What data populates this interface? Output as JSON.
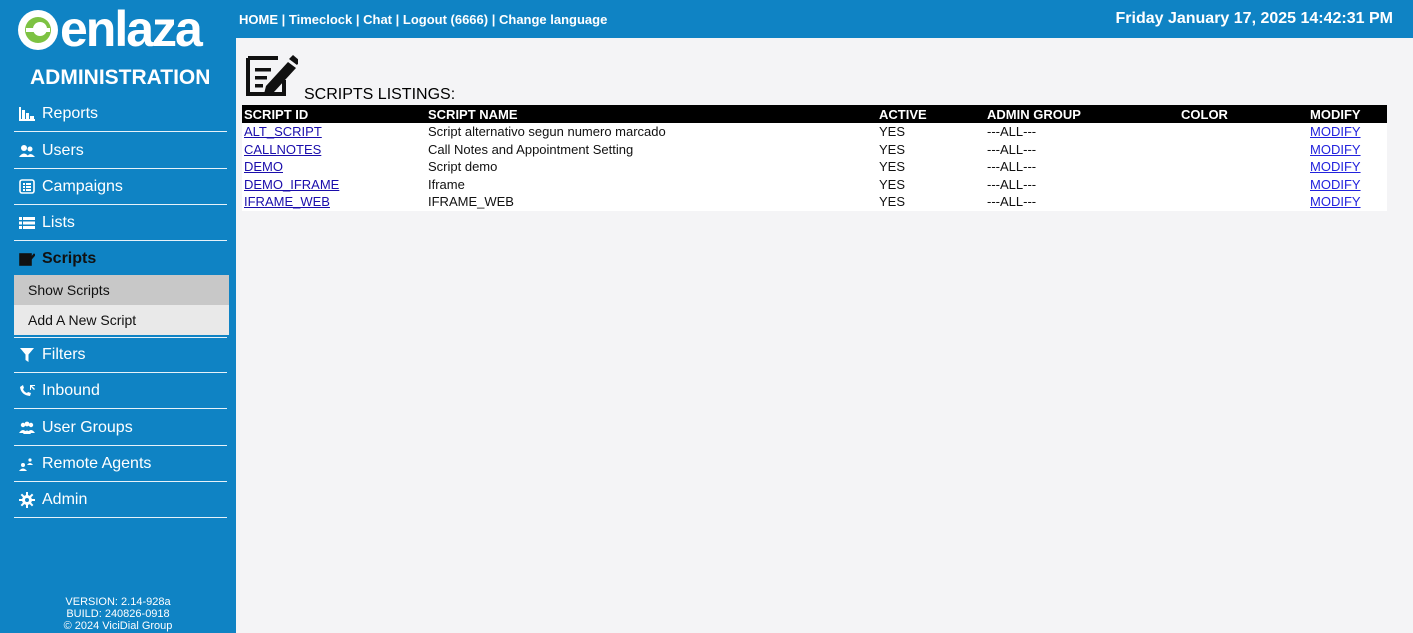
{
  "brand": {
    "logo_text": "enlaza",
    "section_title": "ADMINISTRATION"
  },
  "sidebar": {
    "items": [
      {
        "label": "Reports",
        "icon": "reports-icon"
      },
      {
        "label": "Users",
        "icon": "users-icon"
      },
      {
        "label": "Campaigns",
        "icon": "campaigns-icon"
      },
      {
        "label": "Lists",
        "icon": "lists-icon"
      },
      {
        "label": "Scripts",
        "icon": "scripts-icon",
        "active": true
      },
      {
        "label": "Filters",
        "icon": "filter-icon"
      },
      {
        "label": "Inbound",
        "icon": "inbound-icon"
      },
      {
        "label": "User Groups",
        "icon": "user-groups-icon"
      },
      {
        "label": "Remote Agents",
        "icon": "remote-agents-icon"
      },
      {
        "label": "Admin",
        "icon": "gear-icon"
      }
    ],
    "sub_items": [
      {
        "label": "Show Scripts",
        "selected": true
      },
      {
        "label": "Add A New Script",
        "selected": false
      }
    ],
    "footer": {
      "version": "VERSION: 2.14-928a",
      "build": "BUILD: 240826-0918",
      "copyright": "© 2024 ViciDial Group"
    }
  },
  "topbar": {
    "links": [
      "HOME",
      "Timeclock",
      "Chat",
      "Logout (6666)",
      "Change language"
    ],
    "separator": " | ",
    "datetime": "Friday January 17, 2025 14:42:31 PM"
  },
  "main": {
    "heading": "SCRIPTS LISTINGS:",
    "table": {
      "columns": [
        "SCRIPT ID",
        "SCRIPT NAME",
        "ACTIVE",
        "ADMIN GROUP",
        "COLOR",
        "MODIFY"
      ],
      "rows": [
        {
          "id": "ALT_SCRIPT",
          "name": "Script alternativo segun numero marcado",
          "active": "YES",
          "group": "---ALL---",
          "color": "",
          "modify": "MODIFY"
        },
        {
          "id": "CALLNOTES",
          "name": "Call Notes and Appointment Setting",
          "active": "YES",
          "group": "---ALL---",
          "color": "",
          "modify": "MODIFY"
        },
        {
          "id": "DEMO",
          "name": "Script demo",
          "active": "YES",
          "group": "---ALL---",
          "color": "",
          "modify": "MODIFY"
        },
        {
          "id": "DEMO_IFRAME",
          "name": "Iframe",
          "active": "YES",
          "group": "---ALL---",
          "color": "",
          "modify": "MODIFY"
        },
        {
          "id": "IFRAME_WEB",
          "name": "IFRAME_WEB",
          "active": "YES",
          "group": "---ALL---",
          "color": "",
          "modify": "MODIFY"
        }
      ]
    }
  },
  "colors": {
    "brand_blue": "#0f83c4",
    "link": "#1a0dab",
    "header_bg": "#000000"
  }
}
